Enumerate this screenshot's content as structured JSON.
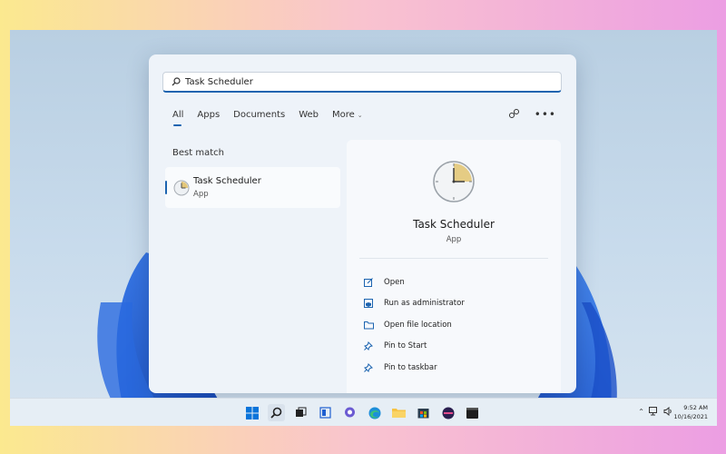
{
  "search": {
    "value": "Task Scheduler",
    "icon": "search-icon"
  },
  "tabs": [
    {
      "label": "All",
      "active": true
    },
    {
      "label": "Apps"
    },
    {
      "label": "Documents"
    },
    {
      "label": "Web"
    },
    {
      "label": "More"
    }
  ],
  "header_icons": [
    "share-icon",
    "more-options-icon"
  ],
  "best_match": {
    "heading": "Best match",
    "name": "Task Scheduler",
    "type": "App",
    "icon": "task-scheduler-clock-icon"
  },
  "details": {
    "name": "Task Scheduler",
    "type": "App",
    "actions": [
      {
        "label": "Open",
        "icon": "open-icon"
      },
      {
        "label": "Run as administrator",
        "icon": "admin-shield-icon"
      },
      {
        "label": "Open file location",
        "icon": "folder-icon"
      },
      {
        "label": "Pin to Start",
        "icon": "pin-icon"
      },
      {
        "label": "Pin to taskbar",
        "icon": "pin-icon"
      }
    ]
  },
  "taskbar": {
    "apps": [
      "windows-start-icon",
      "search-icon",
      "task-view-icon",
      "widgets-icon",
      "chat-icon",
      "edge-icon",
      "file-explorer-icon",
      "store-icon",
      "media-icon",
      "terminal-icon"
    ],
    "tray": [
      "chevron-up-icon",
      "network-icon",
      "volume-icon"
    ],
    "time": "9:52 AM",
    "date": "10/16/2021"
  },
  "colors": {
    "accent": "#1c64b0",
    "bloom": "#1f5fd0"
  }
}
